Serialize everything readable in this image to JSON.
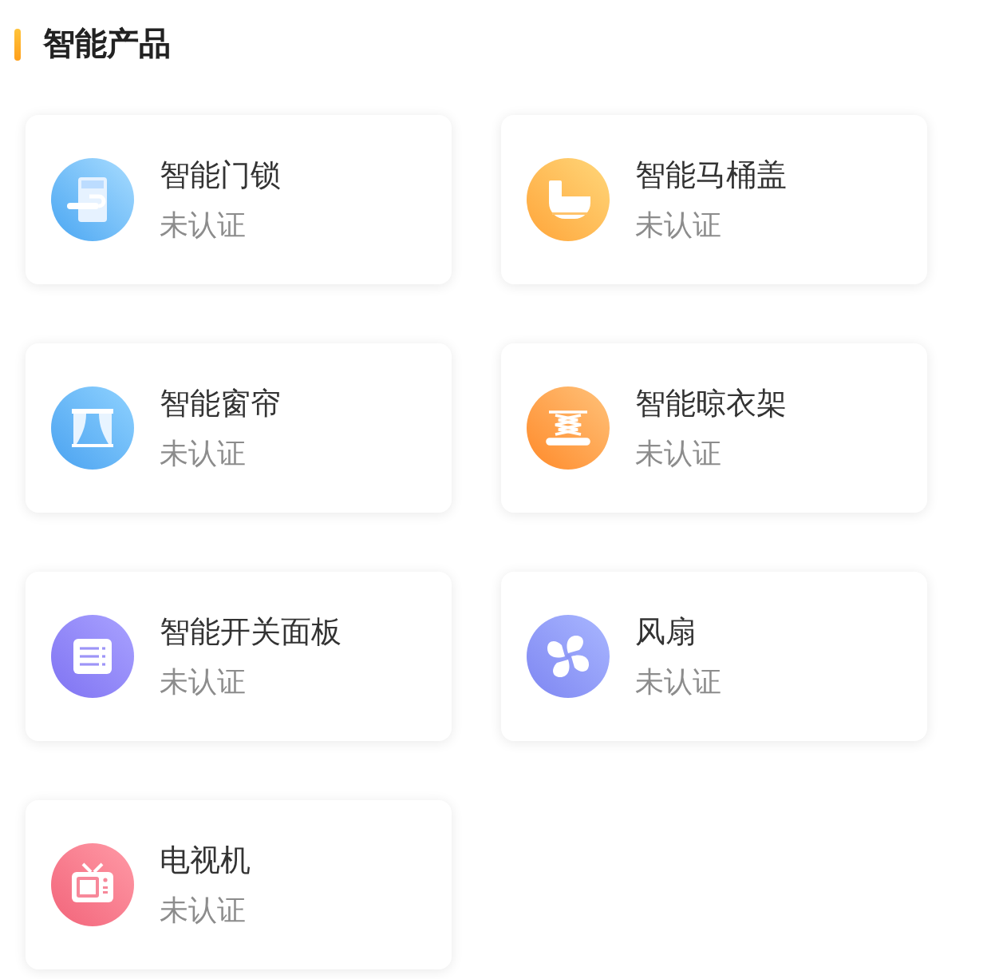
{
  "section": {
    "title": "智能产品"
  },
  "products": [
    {
      "kind": "lock",
      "name": "智能门锁",
      "status": "未认证"
    },
    {
      "kind": "toilet",
      "name": "智能马桶盖",
      "status": "未认证"
    },
    {
      "kind": "curtain",
      "name": "智能窗帘",
      "status": "未认证"
    },
    {
      "kind": "rack",
      "name": "智能晾衣架",
      "status": "未认证"
    },
    {
      "kind": "switch",
      "name": "智能开关面板",
      "status": "未认证"
    },
    {
      "kind": "fan",
      "name": "风扇",
      "status": "未认证"
    },
    {
      "kind": "tv",
      "name": "电视机",
      "status": "未认证"
    }
  ]
}
